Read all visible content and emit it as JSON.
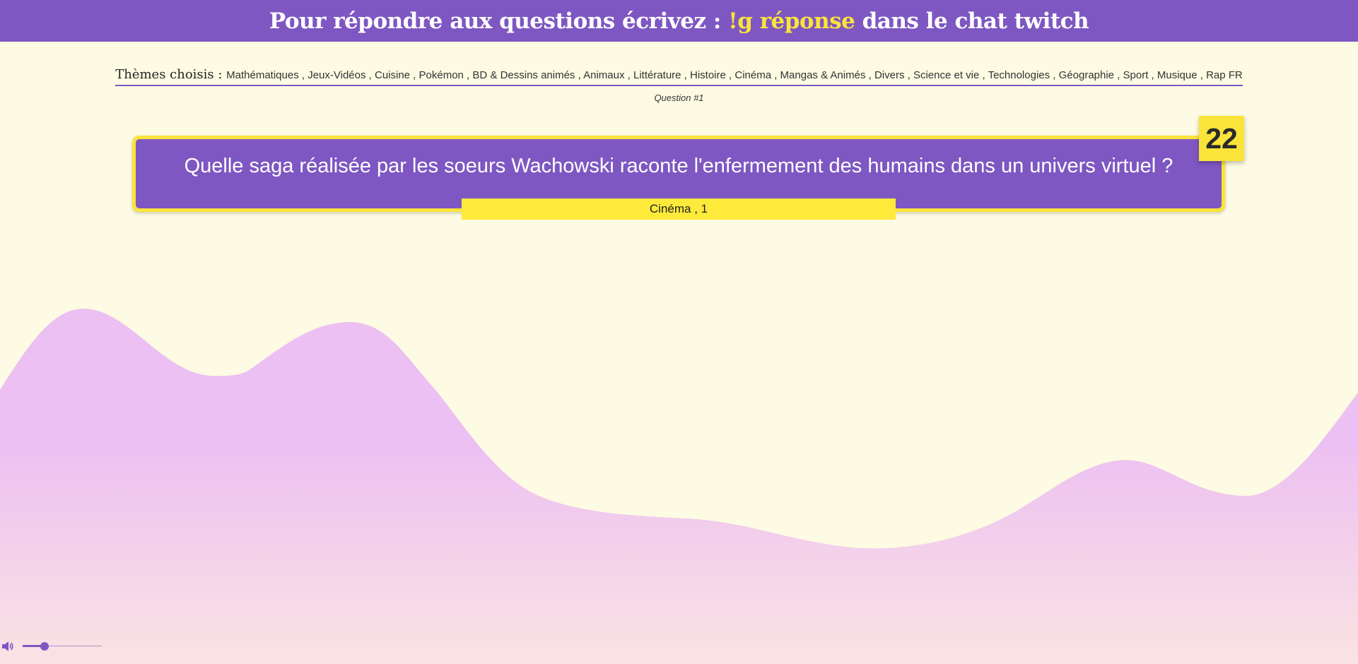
{
  "header": {
    "prefix": "Pour répondre aux questions écrivez : ",
    "command": "!g réponse",
    "suffix": " dans le chat twitch"
  },
  "themes": {
    "label": "Thèmes choisis : ",
    "list": "Mathématiques , Jeux-Vidéos , Cuisine , Pokémon , BD & Dessins animés , Animaux , Littérature , Histoire , Cinéma , Mangas & Animés , Divers , Science et vie , Technologies , Géographie , Sport , Musique , Rap FR"
  },
  "question": {
    "number_label": "Question #1",
    "text": "Quelle saga réalisée par les soeurs Wachowski raconte l'enfermement des humains dans un univers virtuel ?",
    "timer": "22",
    "category": "Cinéma , 1"
  },
  "volume": {
    "level": 0.28,
    "icon": "speaker-icon"
  },
  "colors": {
    "accent": "#7e57c2",
    "highlight": "#fbe43a",
    "background": "#fdfbe3",
    "wave_top": "#ecc0f2",
    "wave_bottom": "#fbe3e3"
  }
}
